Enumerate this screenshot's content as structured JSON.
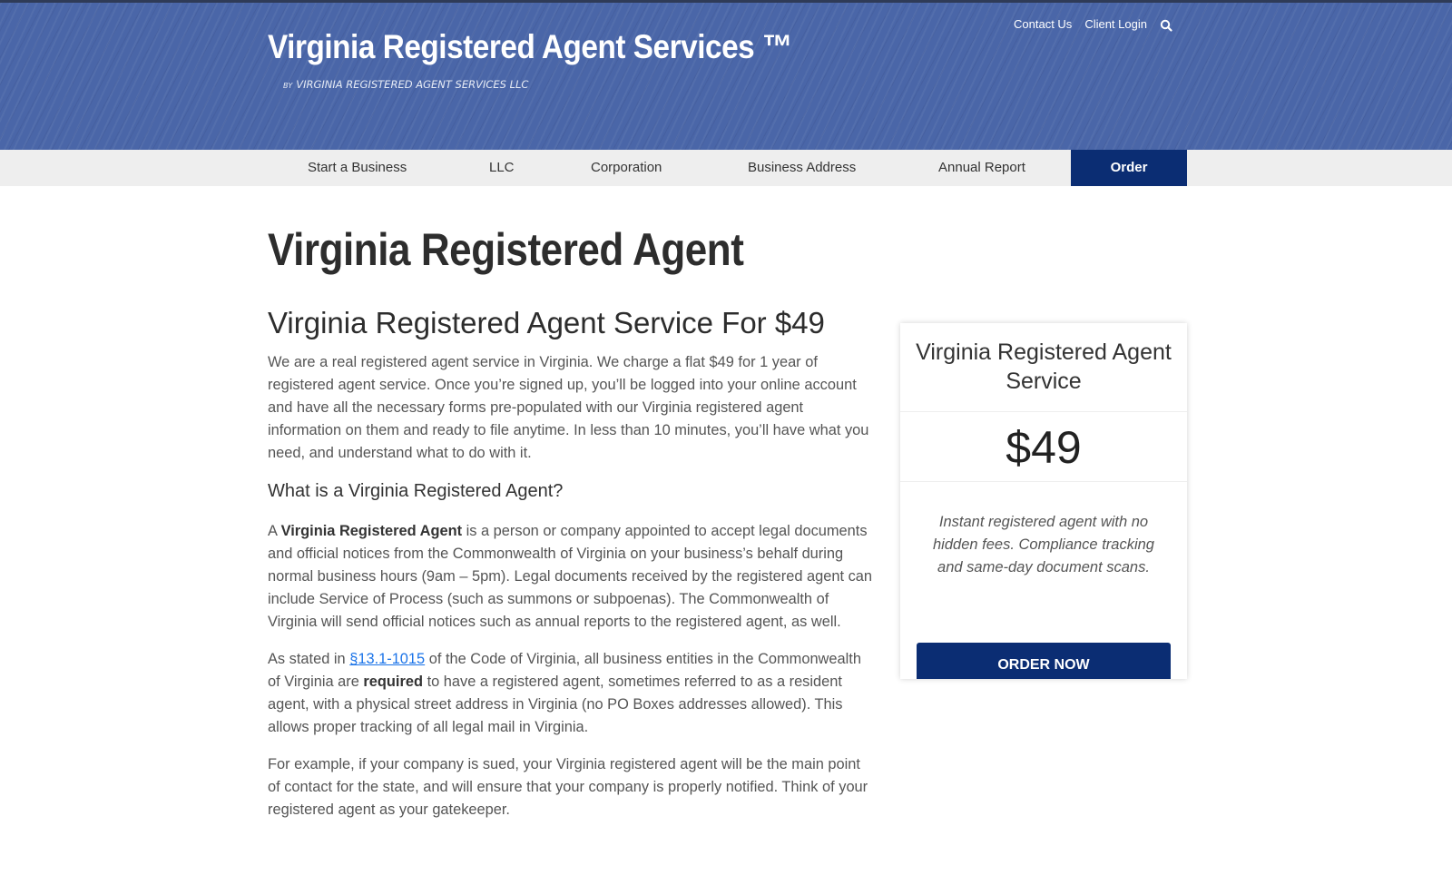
{
  "header": {
    "site_title": "Virginia Registered Agent Services ™",
    "tagline_prefix": "BY",
    "tagline": "VIRGINIA REGISTERED AGENT SERVICES LLC",
    "top_links": [
      "Contact Us",
      "Client Login"
    ],
    "search_icon": "search-icon"
  },
  "nav": {
    "items": [
      "Start a Business",
      "LLC",
      "Corporation",
      "Business Address",
      "Annual Report"
    ],
    "order_label": "Order"
  },
  "main": {
    "page_title": "Virginia Registered Agent",
    "section_title": "Virginia Registered Agent Service For $49",
    "intro": "We are a real registered agent service in Virginia. We charge a flat $49 for 1 year of registered agent service. Once you’re signed up, you’ll be logged into your online account and have all the necessary forms pre-populated with our Virginia registered agent information on them and ready to file anytime. In less than 10 minutes, you’ll have what you need, and understand what to do with it.",
    "what_is_heading": "What is a Virginia Registered Agent?",
    "para1_prefix": "A",
    "para1_bold": "Virginia Registered Agent",
    "para1_rest": "is a person or company appointed to accept legal documents and official notices from the Commonwealth of Virginia on your business’s behalf during normal business hours (9am – 5pm). Legal documents received by the registered agent can include Service of Process (such as summons or subpoenas). The Commonwealth of Virginia will send official notices such as annual reports to the registered agent, as well.",
    "para2_prefix": "As stated in",
    "para2_link": "§13.1-1015",
    "para2_mid": "of the Code of Virginia, all business entities in the Commonwealth of Virginia are",
    "para2_bold": "required",
    "para2_rest": "to have a registered agent, sometimes referred to as a resident agent, with a physical street address in Virginia (no PO Boxes addresses allowed). This allows proper tracking of all legal mail in Virginia.",
    "para3": "For example, if your company is sued, your Virginia registered agent will be the main point of contact for the state, and will ensure that your company is properly notified. Think of your registered agent as your gatekeeper."
  },
  "card": {
    "title": "Virginia Registered Agent Service",
    "price": "$49",
    "description": "Instant registered agent with no hidden fees. Compliance tracking and same-day document scans.",
    "button_label": "ORDER NOW"
  },
  "colors": {
    "header_blue": "#4a66a8",
    "navy": "#0b2d73",
    "link": "#1a73e8"
  }
}
